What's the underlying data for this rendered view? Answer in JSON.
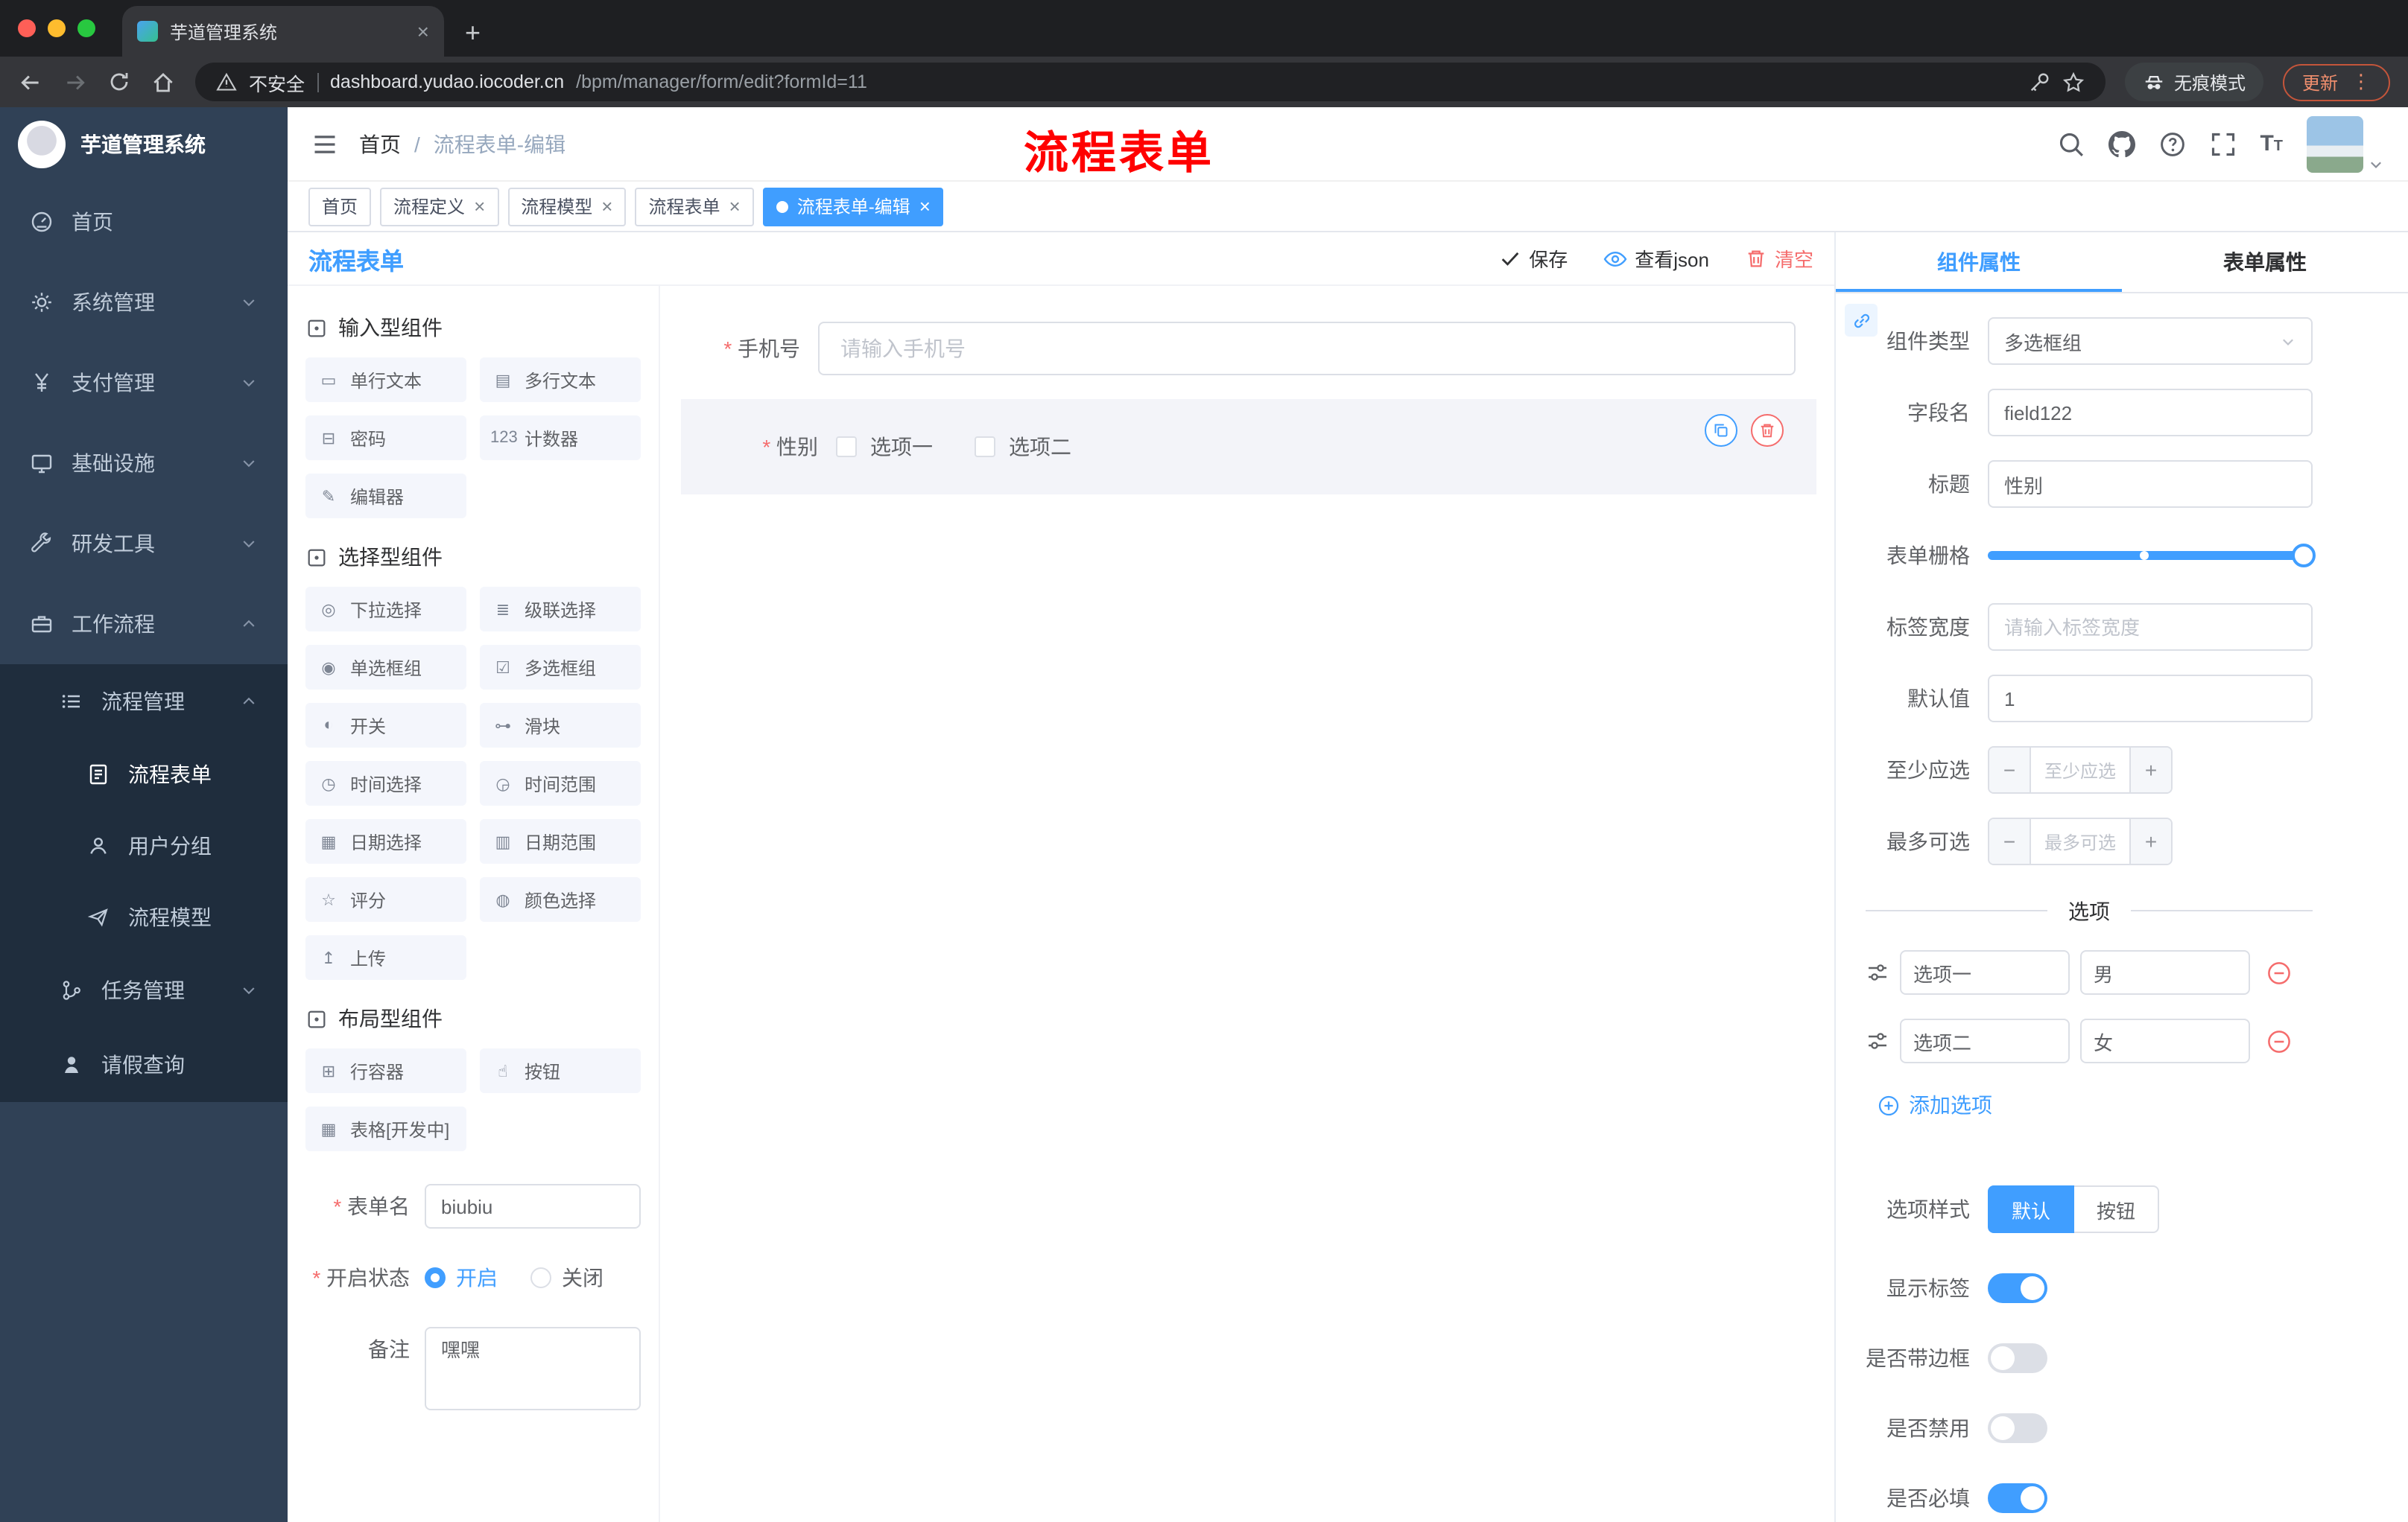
{
  "colors": {
    "primary": "#409EFF",
    "danger": "#F56C6C",
    "sidebar_bg": "#304156",
    "sidebar_sub_bg": "#1F2D3D",
    "annotation_red": "#FF0000",
    "tag_active": "#409EFF"
  },
  "ui": {
    "close": "×",
    "plus": "+",
    "minus": "−",
    "dots": "⋮"
  },
  "browser": {
    "tab_title": "芋道管理系统",
    "security_label": "不安全",
    "url_host": "dashboard.yudao.iocoder.cn",
    "url_path": "/bpm/manager/form/edit?formId=11",
    "incognito_label": "无痕模式",
    "update_label": "更新"
  },
  "sidebar": {
    "brand": "芋道管理系统",
    "items": [
      {
        "label": "首页"
      },
      {
        "label": "系统管理"
      },
      {
        "label": "支付管理"
      },
      {
        "label": "基础设施"
      },
      {
        "label": "研发工具"
      },
      {
        "label": "工作流程"
      },
      {
        "label": "流程管理"
      },
      {
        "label": "流程表单"
      },
      {
        "label": "用户分组"
      },
      {
        "label": "流程模型"
      },
      {
        "label": "任务管理"
      },
      {
        "label": "请假查询"
      }
    ]
  },
  "navbar": {
    "breadcrumb_home": "首页",
    "breadcrumb_sep": "/",
    "breadcrumb_current": "流程表单-编辑",
    "annotation": "流程表单"
  },
  "tags": [
    {
      "label": "首页",
      "active": false
    },
    {
      "label": "流程定义",
      "active": false
    },
    {
      "label": "流程模型",
      "active": false
    },
    {
      "label": "流程表单",
      "active": false
    },
    {
      "label": "流程表单-编辑",
      "active": true
    }
  ],
  "designer": {
    "title": "流程表单",
    "save_label": "保存",
    "view_json_label": "查看json",
    "clear_label": "清空"
  },
  "palette": {
    "groups": [
      {
        "title": "输入型组件",
        "items": [
          {
            "icon": "▭",
            "label": "单行文本"
          },
          {
            "icon": "▤",
            "label": "多行文本"
          },
          {
            "icon": "⊟",
            "label": "密码"
          },
          {
            "icon": "123",
            "label": "计数器"
          },
          {
            "icon": "✎",
            "label": "编辑器"
          }
        ]
      },
      {
        "title": "选择型组件",
        "items": [
          {
            "icon": "◎",
            "label": "下拉选择"
          },
          {
            "icon": "≣",
            "label": "级联选择"
          },
          {
            "icon": "◉",
            "label": "单选框组"
          },
          {
            "icon": "☑",
            "label": "多选框组"
          },
          {
            "icon": "◐",
            "label": "开关"
          },
          {
            "icon": "⊶",
            "label": "滑块"
          },
          {
            "icon": "◷",
            "label": "时间选择"
          },
          {
            "icon": "◶",
            "label": "时间范围"
          },
          {
            "icon": "▦",
            "label": "日期选择"
          },
          {
            "icon": "▥",
            "label": "日期范围"
          },
          {
            "icon": "☆",
            "label": "评分"
          },
          {
            "icon": "◍",
            "label": "颜色选择"
          },
          {
            "icon": "↥",
            "label": "上传"
          }
        ]
      },
      {
        "title": "布局型组件",
        "items": [
          {
            "icon": "⊞",
            "label": "行容器"
          },
          {
            "icon": "☝",
            "label": "按钮"
          },
          {
            "icon": "▦",
            "label": "表格[开发中]"
          }
        ]
      }
    ]
  },
  "form_meta": {
    "name_label": "表单名",
    "name_value": "biubiu",
    "status_label": "开启状态",
    "status_on": "开启",
    "status_off": "关闭",
    "status_on_selected": true,
    "remark_label": "备注",
    "remark_value": "嘿嘿"
  },
  "canvas": {
    "phone_label": "手机号",
    "phone_placeholder": "请输入手机号",
    "gender_label": "性别",
    "gender_options": [
      {
        "label": "选项一"
      },
      {
        "label": "选项二"
      }
    ]
  },
  "props": {
    "tabs": {
      "component": "组件属性",
      "form": "表单属性",
      "component_active": true
    },
    "type_label": "组件类型",
    "type_value": "多选框组",
    "field_label": "字段名",
    "field_value": "field122",
    "title_label": "标题",
    "title_value": "性别",
    "grid_label": "表单栅格",
    "label_width_label": "标签宽度",
    "label_width_placeholder": "请输入标签宽度",
    "default_label": "默认值",
    "default_value": "1",
    "min_label": "至少应选",
    "min_placeholder": "至少应选",
    "max_label": "最多可选",
    "max_placeholder": "最多可选",
    "options_divider": "选项",
    "options": [
      {
        "label": "选项一",
        "value": "男"
      },
      {
        "label": "选项二",
        "value": "女"
      }
    ],
    "add_option_label": "添加选项",
    "style_label": "选项样式",
    "style_options": [
      {
        "label": "默认",
        "active": true
      },
      {
        "label": "按钮",
        "active": false
      }
    ],
    "switches": [
      {
        "label": "显示标签",
        "on": true
      },
      {
        "label": "是否带边框",
        "on": false
      },
      {
        "label": "是否禁用",
        "on": false
      },
      {
        "label": "是否必填",
        "on": true
      }
    ]
  }
}
